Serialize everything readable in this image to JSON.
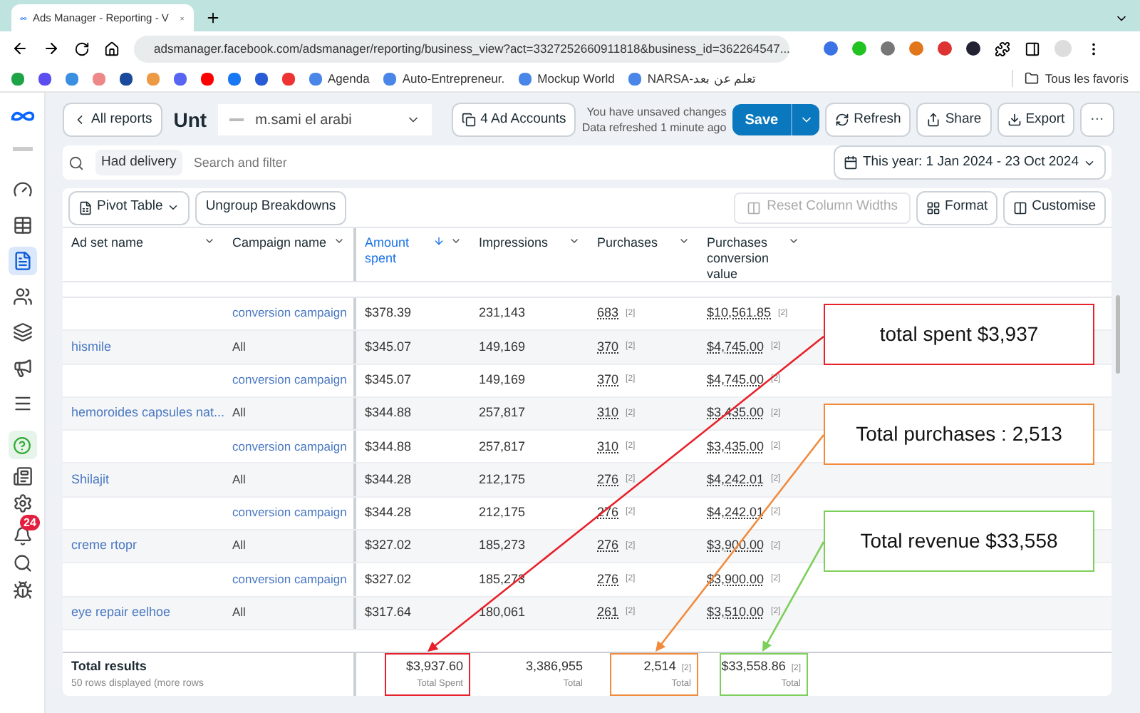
{
  "browser": {
    "tab_title": "Ads Manager - Reporting - V",
    "url": "adsmanager.facebook.com/adsmanager/reporting/business_view?act=3327252660911818&business_id=362264547...",
    "bookmarks": [
      {
        "label": "Agenda"
      },
      {
        "label": "Auto-Entrepreneur."
      },
      {
        "label": "Mockup World"
      },
      {
        "label": "NARSA-تعلم عن بعد"
      }
    ],
    "all_bookmarks": "Tous les favoris"
  },
  "sidebar": {
    "items": [
      {
        "selected": false
      },
      {
        "selected": false
      },
      {
        "selected": true
      },
      {
        "selected": false
      },
      {
        "selected": false
      },
      {
        "selected": false
      },
      {
        "selected": false
      }
    ],
    "notification_count": "24"
  },
  "header": {
    "back": "All reports",
    "report_name": "Unt",
    "account": "m.sami el arabi",
    "ad_accounts": "4 Ad Accounts",
    "status": "You have unsaved changes",
    "refreshed": "Data refreshed 1 minute ago",
    "save": "Save",
    "refresh": "Refresh",
    "share": "Share",
    "export": "Export",
    "more": "···"
  },
  "filter": {
    "chip": "Had delivery",
    "placeholder": "Search and filter",
    "date_range": "This year: 1 Jan 2024 - 23 Oct 2024"
  },
  "toolbar": {
    "view": "Pivot Table",
    "ungroup": "Ungroup Breakdowns",
    "reset": {
      "label": "Reset Column Widths",
      "disabled": true
    },
    "format": "Format",
    "customise": "Customise"
  },
  "table": {
    "columns": [
      {
        "label": "Ad set name",
        "sorted": false
      },
      {
        "label": "Campaign name",
        "sorted": false
      },
      {
        "label": "Amount spent",
        "sorted": true
      },
      {
        "label": "Impressions",
        "sorted": false
      },
      {
        "label": "Purchases",
        "sorted": false
      },
      {
        "label": "Purchases conversion value",
        "sorted": false
      }
    ],
    "rows": [
      {
        "kind": "campaign",
        "ad_set": "",
        "campaign": "conversion campaign",
        "amount": "$378.39",
        "impressions": "231,143",
        "purchases": "683",
        "purchases_note": "[2]",
        "value": "$10,561.85",
        "value_note": "[2]"
      },
      {
        "kind": "group",
        "ad_set": "hismile",
        "campaign": "All",
        "amount": "$345.07",
        "impressions": "149,169",
        "purchases": "370",
        "purchases_note": "[2]",
        "value": "$4,745.00",
        "value_note": "[2]"
      },
      {
        "kind": "campaign",
        "ad_set": "",
        "campaign": "conversion campaign",
        "amount": "$345.07",
        "impressions": "149,169",
        "purchases": "370",
        "purchases_note": "[2]",
        "value": "$4,745.00",
        "value_note": "[2]"
      },
      {
        "kind": "group",
        "ad_set": "hemoroides capsules nat...",
        "campaign": "All",
        "amount": "$344.88",
        "impressions": "257,817",
        "purchases": "310",
        "purchases_note": "[2]",
        "value": "$3,435.00",
        "value_note": "[2]"
      },
      {
        "kind": "campaign",
        "ad_set": "",
        "campaign": "conversion campaign",
        "amount": "$344.88",
        "impressions": "257,817",
        "purchases": "310",
        "purchases_note": "[2]",
        "value": "$3,435.00",
        "value_note": "[2]"
      },
      {
        "kind": "group",
        "ad_set": "Shilajit",
        "campaign": "All",
        "amount": "$344.28",
        "impressions": "212,175",
        "purchases": "276",
        "purchases_note": "[2]",
        "value": "$4,242.01",
        "value_note": "[2]"
      },
      {
        "kind": "campaign",
        "ad_set": "",
        "campaign": "conversion campaign",
        "amount": "$344.28",
        "impressions": "212,175",
        "purchases": "276",
        "purchases_note": "[2]",
        "value": "$4,242.01",
        "value_note": "[2]"
      },
      {
        "kind": "group",
        "ad_set": "creme rtopr",
        "campaign": "All",
        "amount": "$327.02",
        "impressions": "185,273",
        "purchases": "276",
        "purchases_note": "[2]",
        "value": "$3,900.00",
        "value_note": "[2]"
      },
      {
        "kind": "campaign",
        "ad_set": "",
        "campaign": "conversion campaign",
        "amount": "$327.02",
        "impressions": "185,273",
        "purchases": "276",
        "purchases_note": "[2]",
        "value": "$3,900.00",
        "value_note": "[2]"
      },
      {
        "kind": "group",
        "ad_set": "eye repair eelhoe",
        "campaign": "All",
        "amount": "$317.64",
        "impressions": "180,061",
        "purchases": "261",
        "purchases_note": "[2]",
        "value": "$3,510.00",
        "value_note": "[2]"
      }
    ],
    "totals": {
      "title": "Total results",
      "subtitle": "50 rows displayed (more rows",
      "cells": [
        {
          "value": "$3,937.60",
          "label": "Total Spent",
          "color": "#e8202a"
        },
        {
          "value": "3,386,955",
          "label": "Total"
        },
        {
          "value": "2,514",
          "note": "[2]",
          "label": "Total",
          "color": "#f28a3c"
        },
        {
          "value": "$33,558.86",
          "note": "[2]",
          "label": "Total",
          "color": "#7ccf5a"
        }
      ]
    }
  },
  "annotations": [
    {
      "text": "total spent $3,937",
      "color": "#e8202a"
    },
    {
      "text": "Total purchases : 2,513",
      "color": "#f28a3c"
    },
    {
      "text": "Total revenue $33,558",
      "color": "#7ccf5a"
    }
  ]
}
